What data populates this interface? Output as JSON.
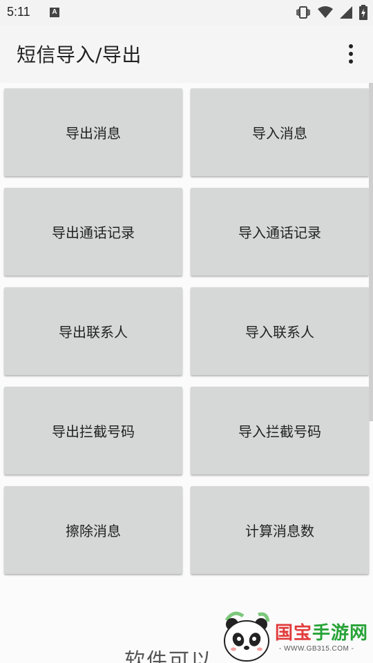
{
  "status_bar": {
    "time": "5:11",
    "notification_badge": "A",
    "icons": [
      "vibrate-icon",
      "wifi-icon",
      "signal-icon",
      "battery-icon"
    ]
  },
  "app_bar": {
    "title": "短信导入/导出",
    "menu_icon": "overflow-menu-icon"
  },
  "buttons": [
    {
      "label": "导出消息"
    },
    {
      "label": "导入消息"
    },
    {
      "label": "导出通话记录"
    },
    {
      "label": "导入通话记录"
    },
    {
      "label": "导出联系人"
    },
    {
      "label": "导入联系人"
    },
    {
      "label": "导出拦截号码"
    },
    {
      "label": "导入拦截号码"
    },
    {
      "label": "擦除消息"
    },
    {
      "label": "计算消息数"
    }
  ],
  "footer": {
    "partial_text": "软件可以"
  },
  "watermark": {
    "brand_part1": "国宝",
    "brand_part2": "手游网",
    "url": "- WWW.GB315.COM -"
  },
  "colors": {
    "button_bg": "#d6d7d7",
    "brand_green": "#27a337",
    "brand_red": "#e23b3b"
  }
}
